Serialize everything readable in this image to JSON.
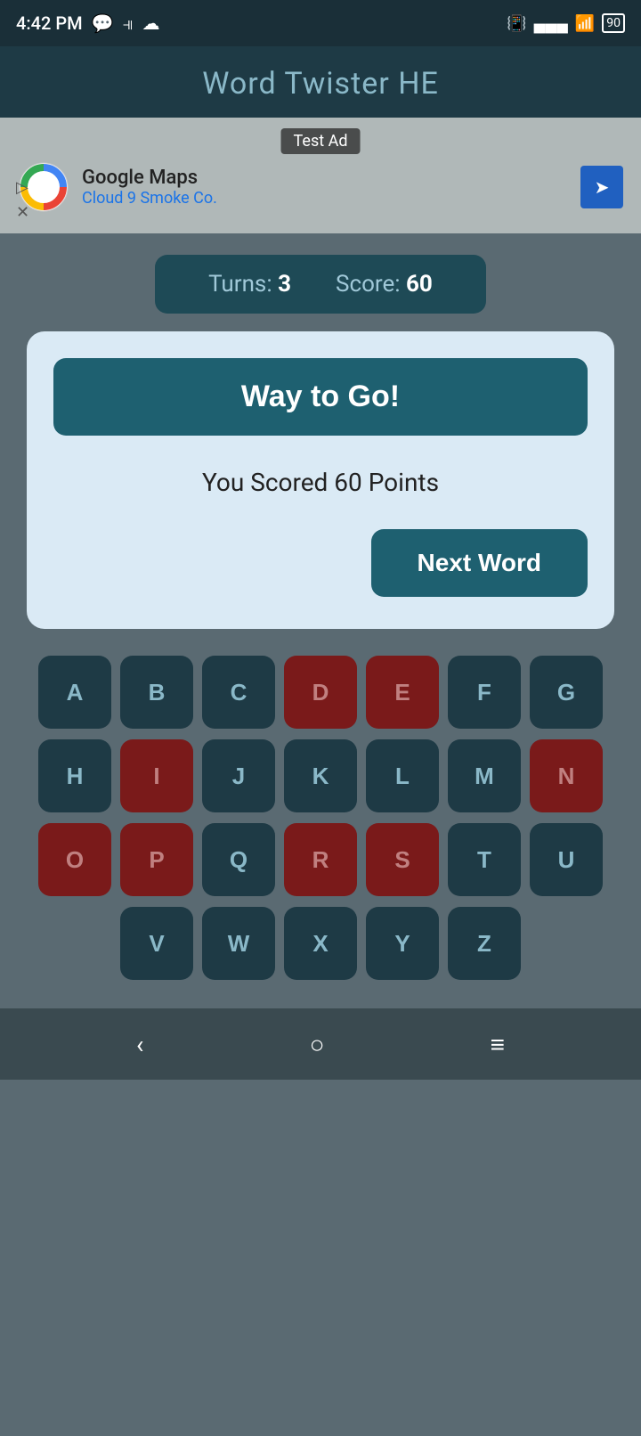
{
  "status_bar": {
    "time": "4:42 PM",
    "battery": "90"
  },
  "header": {
    "title": "Word Twister HE"
  },
  "ad": {
    "label": "Test Ad",
    "name": "Google Maps",
    "sub": "Cloud 9 Smoke Co."
  },
  "score_bar": {
    "turns_label": "Turns:",
    "turns_value": "3",
    "score_label": "Score:",
    "score_value": "60"
  },
  "modal": {
    "way_to_go": "Way to Go!",
    "scored_text": "You Scored 60 Points",
    "next_word": "Next Word"
  },
  "keyboard": {
    "rows": [
      [
        "A",
        "B",
        "C",
        "D",
        "E",
        "F",
        "G"
      ],
      [
        "H",
        "I",
        "J",
        "K",
        "L",
        "M",
        "N"
      ],
      [
        "O",
        "P",
        "Q",
        "R",
        "S",
        "T",
        "U"
      ],
      [
        "V",
        "W",
        "X",
        "Y",
        "Z"
      ]
    ],
    "used_keys": [
      "D",
      "E",
      "I",
      "N",
      "O",
      "P",
      "R",
      "S"
    ]
  },
  "nav": {
    "back": "‹",
    "home": "○",
    "menu": "≡"
  }
}
